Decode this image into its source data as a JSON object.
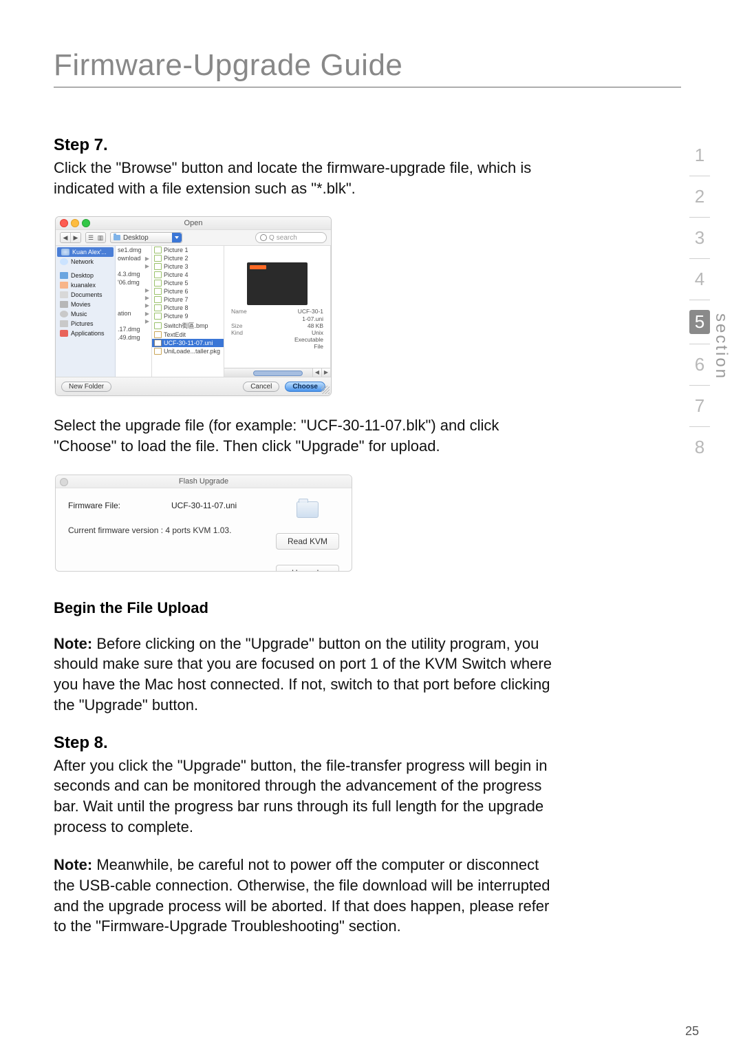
{
  "page_title": "Firmware-Upgrade Guide",
  "page_number": "25",
  "section_label": "section",
  "nav": {
    "items": [
      "1",
      "2",
      "3",
      "4",
      "5",
      "6",
      "7",
      "8"
    ],
    "active": "5"
  },
  "step7": {
    "heading": "Step 7.",
    "body": "Click the \"Browse\" button and locate the firmware-upgrade file, which is indicated with a file extension such as \"*.blk\".",
    "after_dialog": "Select the upgrade file (for example: \"UCF-30-11-07.blk\") and click \"Choose\" to load the file. Then click \"Upgrade\" for upload."
  },
  "open_dialog": {
    "title": "Open",
    "location": "Desktop",
    "search_placeholder": "search",
    "sidebar": {
      "devices": [
        {
          "label": "Kuan Alex'...",
          "kind": "disk",
          "selected": true
        },
        {
          "label": "Network",
          "kind": "net"
        }
      ],
      "places": [
        {
          "label": "Desktop",
          "kind": "desk"
        },
        {
          "label": "kuanalex",
          "kind": "home"
        },
        {
          "label": "Documents",
          "kind": "doc"
        },
        {
          "label": "Movies",
          "kind": "mov"
        },
        {
          "label": "Music",
          "kind": "mus"
        },
        {
          "label": "Pictures",
          "kind": "pic"
        },
        {
          "label": "Applications",
          "kind": "app"
        }
      ]
    },
    "col1": [
      "se1.dmg",
      "ownload",
      "",
      "4.3.dmg",
      "'06.dmg",
      "",
      "",
      "",
      "ation",
      "",
      ".17.dmg",
      ".49.dmg"
    ],
    "col2": [
      {
        "label": "Picture 1"
      },
      {
        "label": "Picture 2"
      },
      {
        "label": "Picture 3"
      },
      {
        "label": "Picture 4"
      },
      {
        "label": "Picture 5"
      },
      {
        "label": "Picture 6"
      },
      {
        "label": "Picture 7"
      },
      {
        "label": "Picture 8"
      },
      {
        "label": "Picture 9"
      },
      {
        "label": "Switch街區.bmp"
      },
      {
        "label": "TextEdit"
      },
      {
        "label": "UCF-30-11-07.uni",
        "selected": true
      },
      {
        "label": "UniLoade...taller.pkg"
      }
    ],
    "preview": {
      "name_k": "Name",
      "name_v": "UCF-30-1\n1-07.uni",
      "size_k": "Size",
      "size_v": "48 KB",
      "kind_k": "Kind",
      "kind_v": "Unix\nExecutable\nFile"
    },
    "footer": {
      "new_folder": "New Folder",
      "cancel": "Cancel",
      "choose": "Choose"
    }
  },
  "flash_dialog": {
    "title": "Flash Upgrade",
    "file_label": "Firmware File:",
    "file_value": "UCF-30-11-07.uni",
    "version_line": "Current firmware version : 4 ports KVM 1.03.",
    "read_btn": "Read KVM",
    "upgrade_btn": "Upgrade"
  },
  "begin_upload": {
    "heading": "Begin the File Upload",
    "note_prefix": "Note:",
    "note_body": " Before clicking on the \"Upgrade\" button on the utility program, you should make sure that you are focused on port 1 of the KVM Switch where you have the Mac host connected. If not, switch to that port before clicking the \"Upgrade\" button."
  },
  "step8": {
    "heading": "Step 8.",
    "body": "After you click the \"Upgrade\" button, the file-transfer progress will begin in seconds and can be monitored through the advancement of the progress bar. Wait until the progress bar runs through its full length for the upgrade process to complete.",
    "note_prefix": "Note:",
    "note_body": " Meanwhile, be careful not to power off the computer or disconnect the USB-cable connection. Otherwise, the file download will be interrupted and the upgrade process will be aborted. If that does happen, please refer to the \"Firmware-Upgrade Troubleshooting\" section."
  }
}
